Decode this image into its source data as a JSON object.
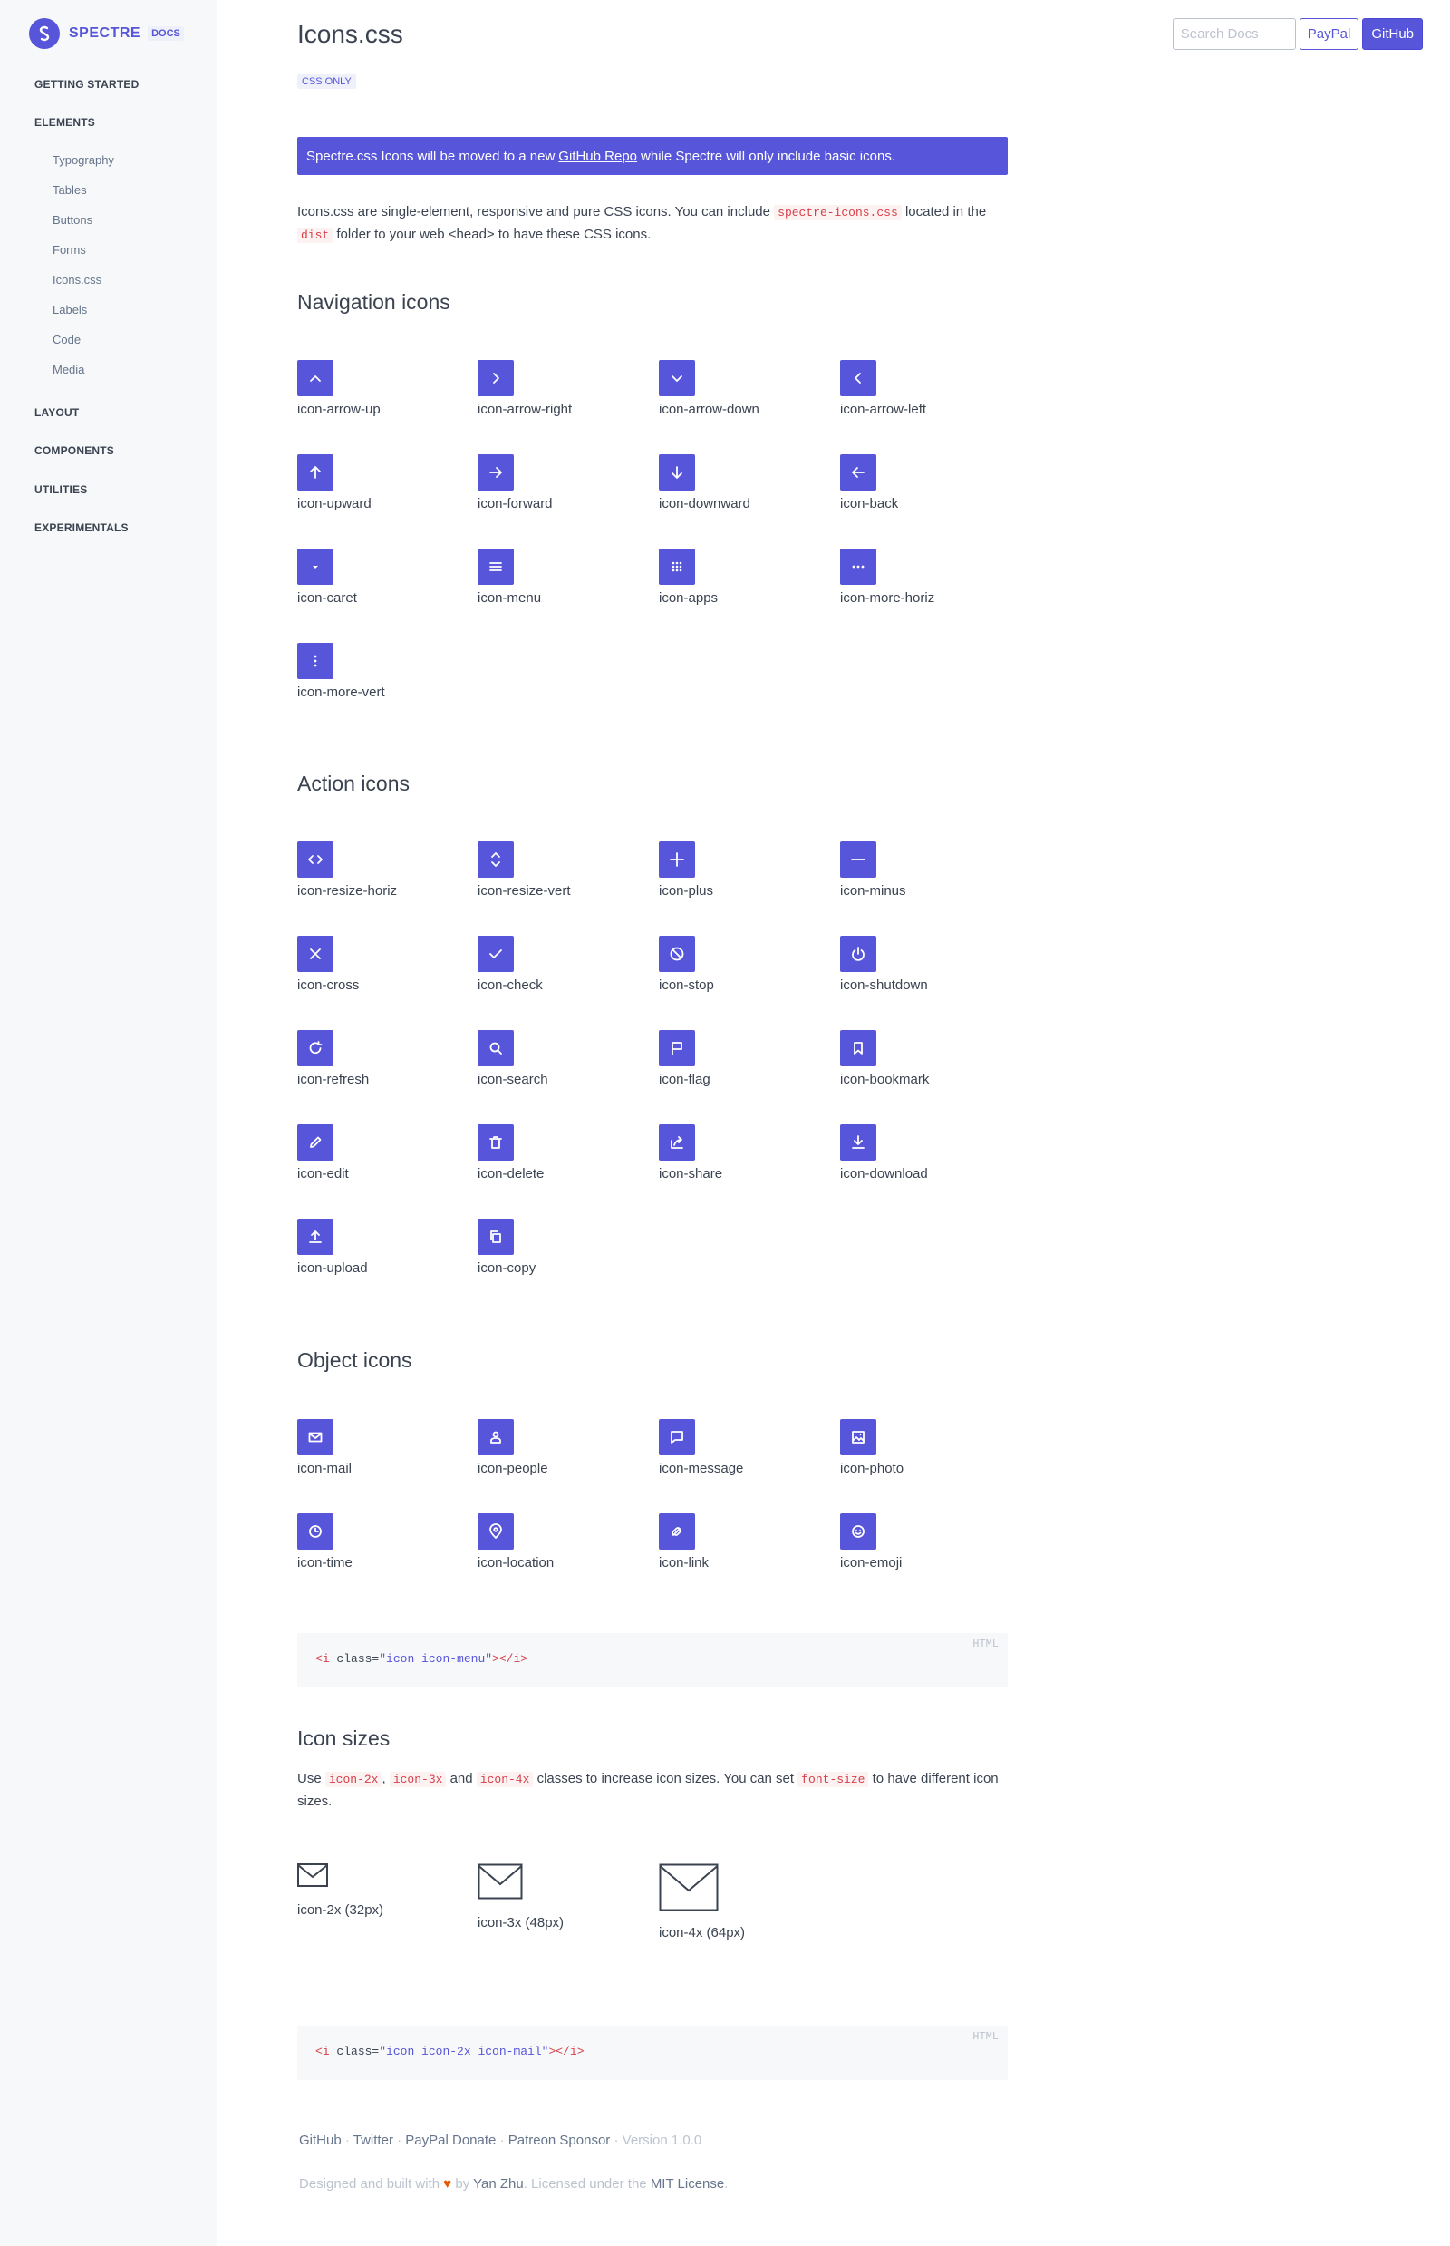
{
  "brand": {
    "name": "SPECTRE",
    "badge": "DOCS"
  },
  "sidebar": {
    "sections": [
      {
        "label": "GETTING STARTED"
      },
      {
        "label": "ELEMENTS",
        "items": [
          "Typography",
          "Tables",
          "Buttons",
          "Forms",
          "Icons.css",
          "Labels",
          "Code",
          "Media"
        ]
      },
      {
        "label": "LAYOUT"
      },
      {
        "label": "COMPONENTS"
      },
      {
        "label": "UTILITIES"
      },
      {
        "label": "EXPERIMENTALS"
      }
    ]
  },
  "topbar": {
    "search_placeholder": "Search Docs",
    "paypal": "PayPal",
    "github": "GitHub"
  },
  "page": {
    "title": "Icons.css",
    "badge": "CSS ONLY",
    "toast": {
      "before": "Spectre.css Icons will be moved to a new",
      "link": "GitHub Repo",
      "after": "while Spectre will only include basic icons."
    },
    "intro": {
      "p1": "Icons.css are single-element, responsive and pure CSS icons. You can include",
      "c1": "spectre-icons.css",
      "p2": "located in the",
      "c2": "dist",
      "p3": "folder to your web <head> to have these CSS icons."
    }
  },
  "sections": {
    "navigation": {
      "title": "Navigation icons",
      "icons": [
        "icon-arrow-up",
        "icon-arrow-right",
        "icon-arrow-down",
        "icon-arrow-left",
        "icon-upward",
        "icon-forward",
        "icon-downward",
        "icon-back",
        "icon-caret",
        "icon-menu",
        "icon-apps",
        "icon-more-horiz",
        "icon-more-vert"
      ]
    },
    "action": {
      "title": "Action icons",
      "icons": [
        "icon-resize-horiz",
        "icon-resize-vert",
        "icon-plus",
        "icon-minus",
        "icon-cross",
        "icon-check",
        "icon-stop",
        "icon-shutdown",
        "icon-refresh",
        "icon-search",
        "icon-flag",
        "icon-bookmark",
        "icon-edit",
        "icon-delete",
        "icon-share",
        "icon-download",
        "icon-upload",
        "icon-copy"
      ]
    },
    "object": {
      "title": "Object icons",
      "icons": [
        "icon-mail",
        "icon-people",
        "icon-message",
        "icon-photo",
        "icon-time",
        "icon-location",
        "icon-link",
        "icon-emoji"
      ]
    }
  },
  "code1": {
    "lang": "HTML",
    "open_lt": "<",
    "tag": "i",
    "attr": " class=",
    "value": "\"icon icon-menu\"",
    "mid": "></",
    "close_gt": ">"
  },
  "sizes": {
    "title": "Icon sizes",
    "text": {
      "p1": "Use",
      "c1": "icon-2x",
      "s1": ",",
      "c2": "icon-3x",
      "p2": "and",
      "c3": "icon-4x",
      "p3": "classes to increase icon sizes. You can set",
      "c4": "font-size",
      "p4": "to have different icon sizes."
    },
    "items": [
      "icon-2x (32px)",
      "icon-3x (48px)",
      "icon-4x (64px)"
    ]
  },
  "code2": {
    "lang": "HTML",
    "open_lt": "<",
    "tag": "i",
    "attr": " class=",
    "value": "\"icon icon-2x icon-mail\"",
    "mid": "></",
    "close_gt": ">"
  },
  "footer": {
    "links": [
      "GitHub",
      "Twitter",
      "PayPal Donate",
      "Patreon Sponsor"
    ],
    "sep": "·",
    "version": "Version 1.0.0",
    "credit_1": "Designed and built with",
    "credit_2": "by",
    "author": "Yan Zhu",
    "credit_3": ". Licensed under the",
    "license": "MIT License",
    "credit_4": "."
  },
  "colors": {
    "primary": "#5755d9",
    "sidebar_bg": "#f7f8f9",
    "code_red": "#d73e48",
    "heart": "#e85600"
  }
}
